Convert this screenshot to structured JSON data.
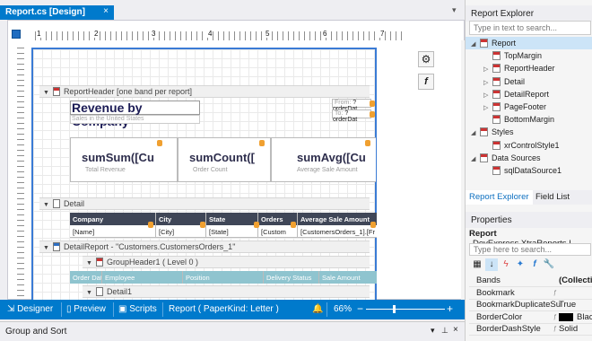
{
  "document_tab": {
    "title": "Report.cs [Design]",
    "close": "×"
  },
  "designer": {
    "ruler_numbers": [
      "1",
      "2",
      "3",
      "4",
      "5",
      "6",
      "7"
    ],
    "bands": {
      "report_header": "ReportHeader [one band per report]",
      "detail": "Detail",
      "detail_report": "DetailReport - \"Customers.CustomersOrders_1\"",
      "group_header": "GroupHeader1 ( Level 0 )",
      "detail1": "Detail1"
    },
    "title": "Revenue by Company",
    "subtitle": "Sales in the United States",
    "params": [
      {
        "label": "From:",
        "value": "?orderDat"
      },
      {
        "label": "To:",
        "value": "?orderDat"
      }
    ],
    "summaries": [
      {
        "value": "sumSum([Cu",
        "label": "Total Revenue"
      },
      {
        "value": "sumCount([",
        "label": "Order Count"
      },
      {
        "value": "sumAvg([Cu",
        "label": "Average Sale Amount"
      }
    ],
    "table_headers": [
      "Company",
      "City",
      "State",
      "Orders",
      "Average Sale Amount"
    ],
    "table_cells": [
      "[Name]",
      "[City]",
      "[State]",
      "[Custom",
      "[CustomersOrders_1].[Fr"
    ],
    "group_headers": [
      "Order Date",
      "Employee",
      "Position",
      "Delivery Status",
      "Sale Amount"
    ]
  },
  "statusbar": {
    "designer": "Designer",
    "preview": "Preview",
    "scripts": "Scripts",
    "report_info": "Report ( PaperKind: Letter )",
    "zoom": "66%",
    "minus": "−",
    "plus": "+"
  },
  "group_sort": {
    "title": "Group and Sort"
  },
  "report_explorer": {
    "title": "Report Explorer",
    "search_placeholder": "Type in text to search...",
    "items": [
      {
        "label": "Report",
        "level": 0,
        "arrow": "◢",
        "selected": true
      },
      {
        "label": "TopMargin",
        "level": 1,
        "arrow": ""
      },
      {
        "label": "ReportHeader",
        "level": 1,
        "arrow": "▷"
      },
      {
        "label": "Detail",
        "level": 1,
        "arrow": "▷"
      },
      {
        "label": "DetailReport",
        "level": 1,
        "arrow": "▷"
      },
      {
        "label": "PageFooter",
        "level": 1,
        "arrow": "▷"
      },
      {
        "label": "BottomMargin",
        "level": 1,
        "arrow": ""
      },
      {
        "label": "Styles",
        "level": 0,
        "arrow": "◢"
      },
      {
        "label": "xrControlStyle1",
        "level": 1,
        "arrow": ""
      },
      {
        "label": "Data Sources",
        "level": 0,
        "arrow": "◢"
      },
      {
        "label": "sqlDataSource1",
        "level": 1,
        "arrow": ""
      }
    ],
    "tabs": [
      "Report Explorer",
      "Field List"
    ]
  },
  "properties": {
    "title": "Properties",
    "selected_name": "Report",
    "selected_type": "DevExpress.XtraReports.I",
    "search_placeholder": "Type here to search...",
    "rows": [
      {
        "name": "Bands",
        "value": "(Collecti",
        "flag": ""
      },
      {
        "name": "Bookmark",
        "value": "",
        "flag": "ƒ"
      },
      {
        "name": "BookmarkDuplicateSu",
        "value": "True",
        "flag": ""
      },
      {
        "name": "BorderColor",
        "value": "Blac",
        "flag": "ƒ"
      },
      {
        "name": "BorderDashStyle",
        "value": "Solid",
        "flag": "ƒ"
      }
    ]
  },
  "colors": {
    "accent": "#007acc",
    "table_header": "#3f4657",
    "group_header": "#8fc4cf"
  }
}
